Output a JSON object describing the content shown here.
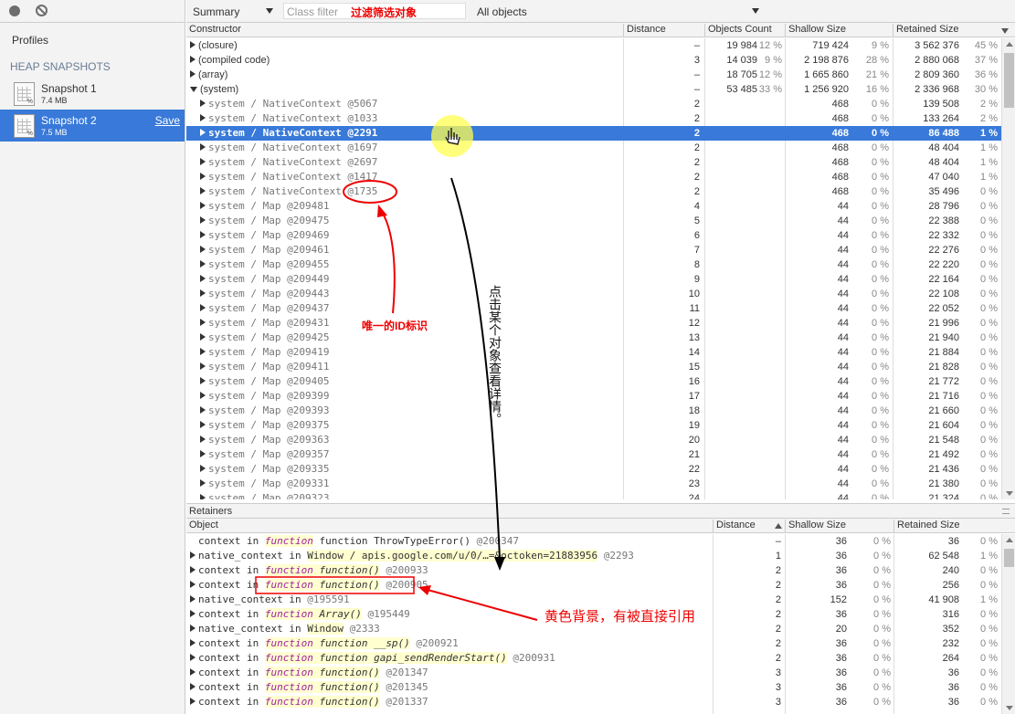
{
  "sidebar": {
    "title": "Profiles",
    "section": "HEAP SNAPSHOTS",
    "snapshots": [
      {
        "name": "Snapshot 1",
        "size": "7.4 MB"
      },
      {
        "name": "Snapshot 2",
        "size": "7.5 MB",
        "action": "Save"
      }
    ]
  },
  "toolbar": {
    "view": "Summary",
    "filter_placeholder": "Class filter",
    "filter_value": "过滤筛选对象",
    "objects": "All objects"
  },
  "constructor_table": {
    "headers": [
      "Constructor",
      "Distance",
      "Objects Count",
      "Shallow Size",
      "Retained Size"
    ],
    "rows": [
      {
        "name": "(closure)",
        "dist": "–",
        "count": "19 984",
        "count_pct": "12 %",
        "shallow": "719 424",
        "shallow_pct": "9 %",
        "retained": "3 562 376",
        "retained_pct": "45 %"
      },
      {
        "name": "(compiled code)",
        "dist": "3",
        "count": "14 039",
        "count_pct": "9 %",
        "shallow": "2 198 876",
        "shallow_pct": "28 %",
        "retained": "2 880 068",
        "retained_pct": "37 %"
      },
      {
        "name": "(array)",
        "dist": "–",
        "count": "18 705",
        "count_pct": "12 %",
        "shallow": "1 665 860",
        "shallow_pct": "21 %",
        "retained": "2 809 360",
        "retained_pct": "36 %"
      },
      {
        "name": "(system)",
        "dist": "–",
        "count": "53 485",
        "count_pct": "33 %",
        "shallow": "1 256 920",
        "shallow_pct": "16 %",
        "retained": "2 336 968",
        "retained_pct": "30 %"
      },
      {
        "name": "system / NativeContext @5067",
        "dist": "2",
        "shallow": "468",
        "shallow_pct": "0 %",
        "retained": "139 508",
        "retained_pct": "2 %"
      },
      {
        "name": "system / NativeContext @1033",
        "dist": "2",
        "shallow": "468",
        "shallow_pct": "0 %",
        "retained": "133 264",
        "retained_pct": "2 %"
      },
      {
        "name": "system / NativeContext @2291",
        "dist": "2",
        "shallow": "468",
        "shallow_pct": "0 %",
        "retained": "86 488",
        "retained_pct": "1 %"
      },
      {
        "name": "system / NativeContext @1697",
        "dist": "2",
        "shallow": "468",
        "shallow_pct": "0 %",
        "retained": "48 404",
        "retained_pct": "1 %"
      },
      {
        "name": "system / NativeContext @2697",
        "dist": "2",
        "shallow": "468",
        "shallow_pct": "0 %",
        "retained": "48 404",
        "retained_pct": "1 %"
      },
      {
        "name": "system / NativeContext @1417",
        "dist": "2",
        "shallow": "468",
        "shallow_pct": "0 %",
        "retained": "47 040",
        "retained_pct": "1 %"
      },
      {
        "name": "system / NativeContext @1735",
        "dist": "2",
        "shallow": "468",
        "shallow_pct": "0 %",
        "retained": "35 496",
        "retained_pct": "0 %"
      },
      {
        "name": "system / Map @209481",
        "dist": "4",
        "shallow": "44",
        "shallow_pct": "0 %",
        "retained": "28 796",
        "retained_pct": "0 %"
      },
      {
        "name": "system / Map @209475",
        "dist": "5",
        "shallow": "44",
        "shallow_pct": "0 %",
        "retained": "22 388",
        "retained_pct": "0 %"
      },
      {
        "name": "system / Map @209469",
        "dist": "6",
        "shallow": "44",
        "shallow_pct": "0 %",
        "retained": "22 332",
        "retained_pct": "0 %"
      },
      {
        "name": "system / Map @209461",
        "dist": "7",
        "shallow": "44",
        "shallow_pct": "0 %",
        "retained": "22 276",
        "retained_pct": "0 %"
      },
      {
        "name": "system / Map @209455",
        "dist": "8",
        "shallow": "44",
        "shallow_pct": "0 %",
        "retained": "22 220",
        "retained_pct": "0 %"
      },
      {
        "name": "system / Map @209449",
        "dist": "9",
        "shallow": "44",
        "shallow_pct": "0 %",
        "retained": "22 164",
        "retained_pct": "0 %"
      },
      {
        "name": "system / Map @209443",
        "dist": "10",
        "shallow": "44",
        "shallow_pct": "0 %",
        "retained": "22 108",
        "retained_pct": "0 %"
      },
      {
        "name": "system / Map @209437",
        "dist": "11",
        "shallow": "44",
        "shallow_pct": "0 %",
        "retained": "22 052",
        "retained_pct": "0 %"
      },
      {
        "name": "system / Map @209431",
        "dist": "12",
        "shallow": "44",
        "shallow_pct": "0 %",
        "retained": "21 996",
        "retained_pct": "0 %"
      },
      {
        "name": "system / Map @209425",
        "dist": "13",
        "shallow": "44",
        "shallow_pct": "0 %",
        "retained": "21 940",
        "retained_pct": "0 %"
      },
      {
        "name": "system / Map @209419",
        "dist": "14",
        "shallow": "44",
        "shallow_pct": "0 %",
        "retained": "21 884",
        "retained_pct": "0 %"
      },
      {
        "name": "system / Map @209411",
        "dist": "15",
        "shallow": "44",
        "shallow_pct": "0 %",
        "retained": "21 828",
        "retained_pct": "0 %"
      },
      {
        "name": "system / Map @209405",
        "dist": "16",
        "shallow": "44",
        "shallow_pct": "0 %",
        "retained": "21 772",
        "retained_pct": "0 %"
      },
      {
        "name": "system / Map @209399",
        "dist": "17",
        "shallow": "44",
        "shallow_pct": "0 %",
        "retained": "21 716",
        "retained_pct": "0 %"
      },
      {
        "name": "system / Map @209393",
        "dist": "18",
        "shallow": "44",
        "shallow_pct": "0 %",
        "retained": "21 660",
        "retained_pct": "0 %"
      },
      {
        "name": "system / Map @209375",
        "dist": "19",
        "shallow": "44",
        "shallow_pct": "0 %",
        "retained": "21 604",
        "retained_pct": "0 %"
      },
      {
        "name": "system / Map @209363",
        "dist": "20",
        "shallow": "44",
        "shallow_pct": "0 %",
        "retained": "21 548",
        "retained_pct": "0 %"
      },
      {
        "name": "system / Map @209357",
        "dist": "21",
        "shallow": "44",
        "shallow_pct": "0 %",
        "retained": "21 492",
        "retained_pct": "0 %"
      },
      {
        "name": "system / Map @209335",
        "dist": "22",
        "shallow": "44",
        "shallow_pct": "0 %",
        "retained": "21 436",
        "retained_pct": "0 %"
      },
      {
        "name": "system / Map @209331",
        "dist": "23",
        "shallow": "44",
        "shallow_pct": "0 %",
        "retained": "21 380",
        "retained_pct": "0 %"
      },
      {
        "name": "system / Map @209323",
        "dist": "24",
        "shallow": "44",
        "shallow_pct": "0 %",
        "retained": "21 324",
        "retained_pct": "0 %"
      }
    ]
  },
  "retainers": {
    "title": "Retainers",
    "headers": [
      "Object",
      "Distance",
      "Shallow Size",
      "Retained Size"
    ],
    "rows": [
      {
        "pre": "context in ",
        "fn": "function",
        "name": " function ThrowTypeError()",
        "id": " @200347",
        "dist": "–",
        "shallow": "36",
        "shallow_pct": "0 %",
        "retained": "36",
        "retained_pct": "0 %",
        "expand": false,
        "hl": false
      },
      {
        "pre": "native_context in ",
        "fn": "",
        "name": "Window / apis.google.com/u/0/…=&octoken=21883956",
        "id": " @2293",
        "dist": "1",
        "shallow": "36",
        "shallow_pct": "0 %",
        "retained": "62 548",
        "retained_pct": "1 %",
        "expand": true,
        "hl": true
      },
      {
        "pre": "context in ",
        "fn": "function",
        "name": " function()",
        "id": " @200933",
        "dist": "2",
        "shallow": "36",
        "shallow_pct": "0 %",
        "retained": "240",
        "retained_pct": "0 %",
        "expand": true,
        "hl": true
      },
      {
        "pre": "context in ",
        "fn": "function",
        "name": " function()",
        "id": " @200905",
        "dist": "2",
        "shallow": "36",
        "shallow_pct": "0 %",
        "retained": "256",
        "retained_pct": "0 %",
        "expand": true,
        "hl": true
      },
      {
        "pre": "native_context in ",
        "fn": "",
        "name": "",
        "id": "@195591",
        "dist": "2",
        "shallow": "152",
        "shallow_pct": "0 %",
        "retained": "41 908",
        "retained_pct": "1 %",
        "expand": true,
        "hl": false
      },
      {
        "pre": "context in ",
        "fn": "function",
        "name": " Array()",
        "id": " @195449",
        "dist": "2",
        "shallow": "36",
        "shallow_pct": "0 %",
        "retained": "316",
        "retained_pct": "0 %",
        "expand": true,
        "hl": true
      },
      {
        "pre": "native_context in ",
        "fn": "",
        "name": "Window",
        "id": " @2333",
        "dist": "2",
        "shallow": "20",
        "shallow_pct": "0 %",
        "retained": "352",
        "retained_pct": "0 %",
        "expand": true,
        "hl": true
      },
      {
        "pre": "context in ",
        "fn": "function",
        "name": " function __sp()",
        "id": " @200921",
        "dist": "2",
        "shallow": "36",
        "shallow_pct": "0 %",
        "retained": "232",
        "retained_pct": "0 %",
        "expand": true,
        "hl": true
      },
      {
        "pre": "context in ",
        "fn": "function",
        "name": " function gapi_sendRenderStart()",
        "id": " @200931",
        "dist": "2",
        "shallow": "36",
        "shallow_pct": "0 %",
        "retained": "264",
        "retained_pct": "0 %",
        "expand": true,
        "hl": true
      },
      {
        "pre": "context in ",
        "fn": "function",
        "name": " function()",
        "id": " @201347",
        "dist": "3",
        "shallow": "36",
        "shallow_pct": "0 %",
        "retained": "36",
        "retained_pct": "0 %",
        "expand": true,
        "hl": true
      },
      {
        "pre": "context in ",
        "fn": "function",
        "name": " function()",
        "id": " @201345",
        "dist": "3",
        "shallow": "36",
        "shallow_pct": "0 %",
        "retained": "36",
        "retained_pct": "0 %",
        "expand": true,
        "hl": true
      },
      {
        "pre": "context in ",
        "fn": "function",
        "name": " function()",
        "id": " @201337",
        "dist": "3",
        "shallow": "36",
        "shallow_pct": "0 %",
        "retained": "36",
        "retained_pct": "0 %",
        "expand": true,
        "hl": true
      }
    ]
  },
  "annotations": {
    "unique_id": "唯一的ID标识",
    "click_detail": "点击某个对象查看详情。",
    "yellow_bg": "黄色背景，有被直接引用"
  },
  "colors": {
    "selection": "#3879d9",
    "annotation": "#e00000",
    "highlight": "#ffffd0"
  }
}
